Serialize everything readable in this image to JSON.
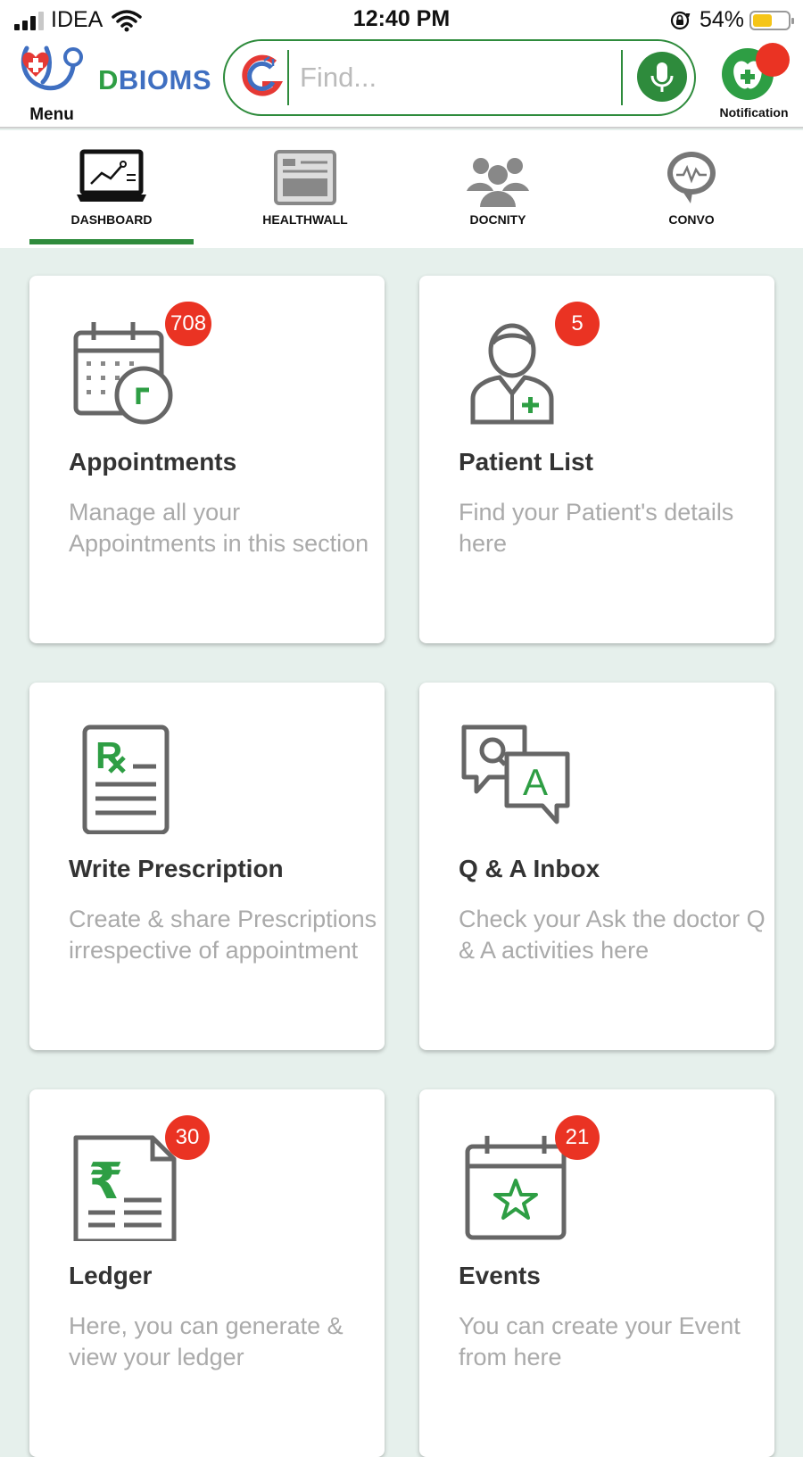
{
  "status_bar": {
    "carrier": "IDEA",
    "time": "12:40 PM",
    "battery_percent": "54%",
    "battery_level": 0.54,
    "battery_color": "#f5c518",
    "icons": [
      "signal-icon",
      "wifi-icon",
      "rotation-lock-icon",
      "battery-icon"
    ]
  },
  "header": {
    "menu_label": "Menu",
    "brand": {
      "first_letter": "D",
      "rest": "BIOMS"
    },
    "search_placeholder": "Find...",
    "notification_label": "Notification",
    "accent_color": "#2e8b3c",
    "alert_color": "#ea3323"
  },
  "tabs": [
    {
      "label": "DASHBOARD",
      "icon": "dashboard-laptop-icon",
      "selected": true
    },
    {
      "label": "HEALTHWALL",
      "icon": "healthwall-icon",
      "selected": false
    },
    {
      "label": "DOCNITY",
      "icon": "community-icon",
      "selected": false
    },
    {
      "label": "CONVO",
      "icon": "chat-bubble-icon",
      "selected": false
    }
  ],
  "cards": [
    {
      "title": "Appointments",
      "description": "Manage all your Appointments in this section",
      "badge": "708",
      "icon": "calendar-clock-icon"
    },
    {
      "title": "Patient List",
      "description": "Find your Patient's details here",
      "badge": "5",
      "icon": "patient-icon"
    },
    {
      "title": "Write Prescription",
      "description": "Create & share Prescriptions irrespective of appointment",
      "badge": "",
      "icon": "prescription-icon"
    },
    {
      "title": "Q & A Inbox",
      "description": "Check your Ask the doctor Q & A activities here",
      "badge": "",
      "icon": "qa-bubbles-icon"
    },
    {
      "title": "Ledger",
      "description": "Here, you can generate & view your ledger",
      "badge": "30",
      "icon": "ledger-rupee-icon"
    },
    {
      "title": "Events",
      "description": "You can create your Event from here",
      "badge": "21",
      "icon": "calendar-star-icon"
    }
  ]
}
